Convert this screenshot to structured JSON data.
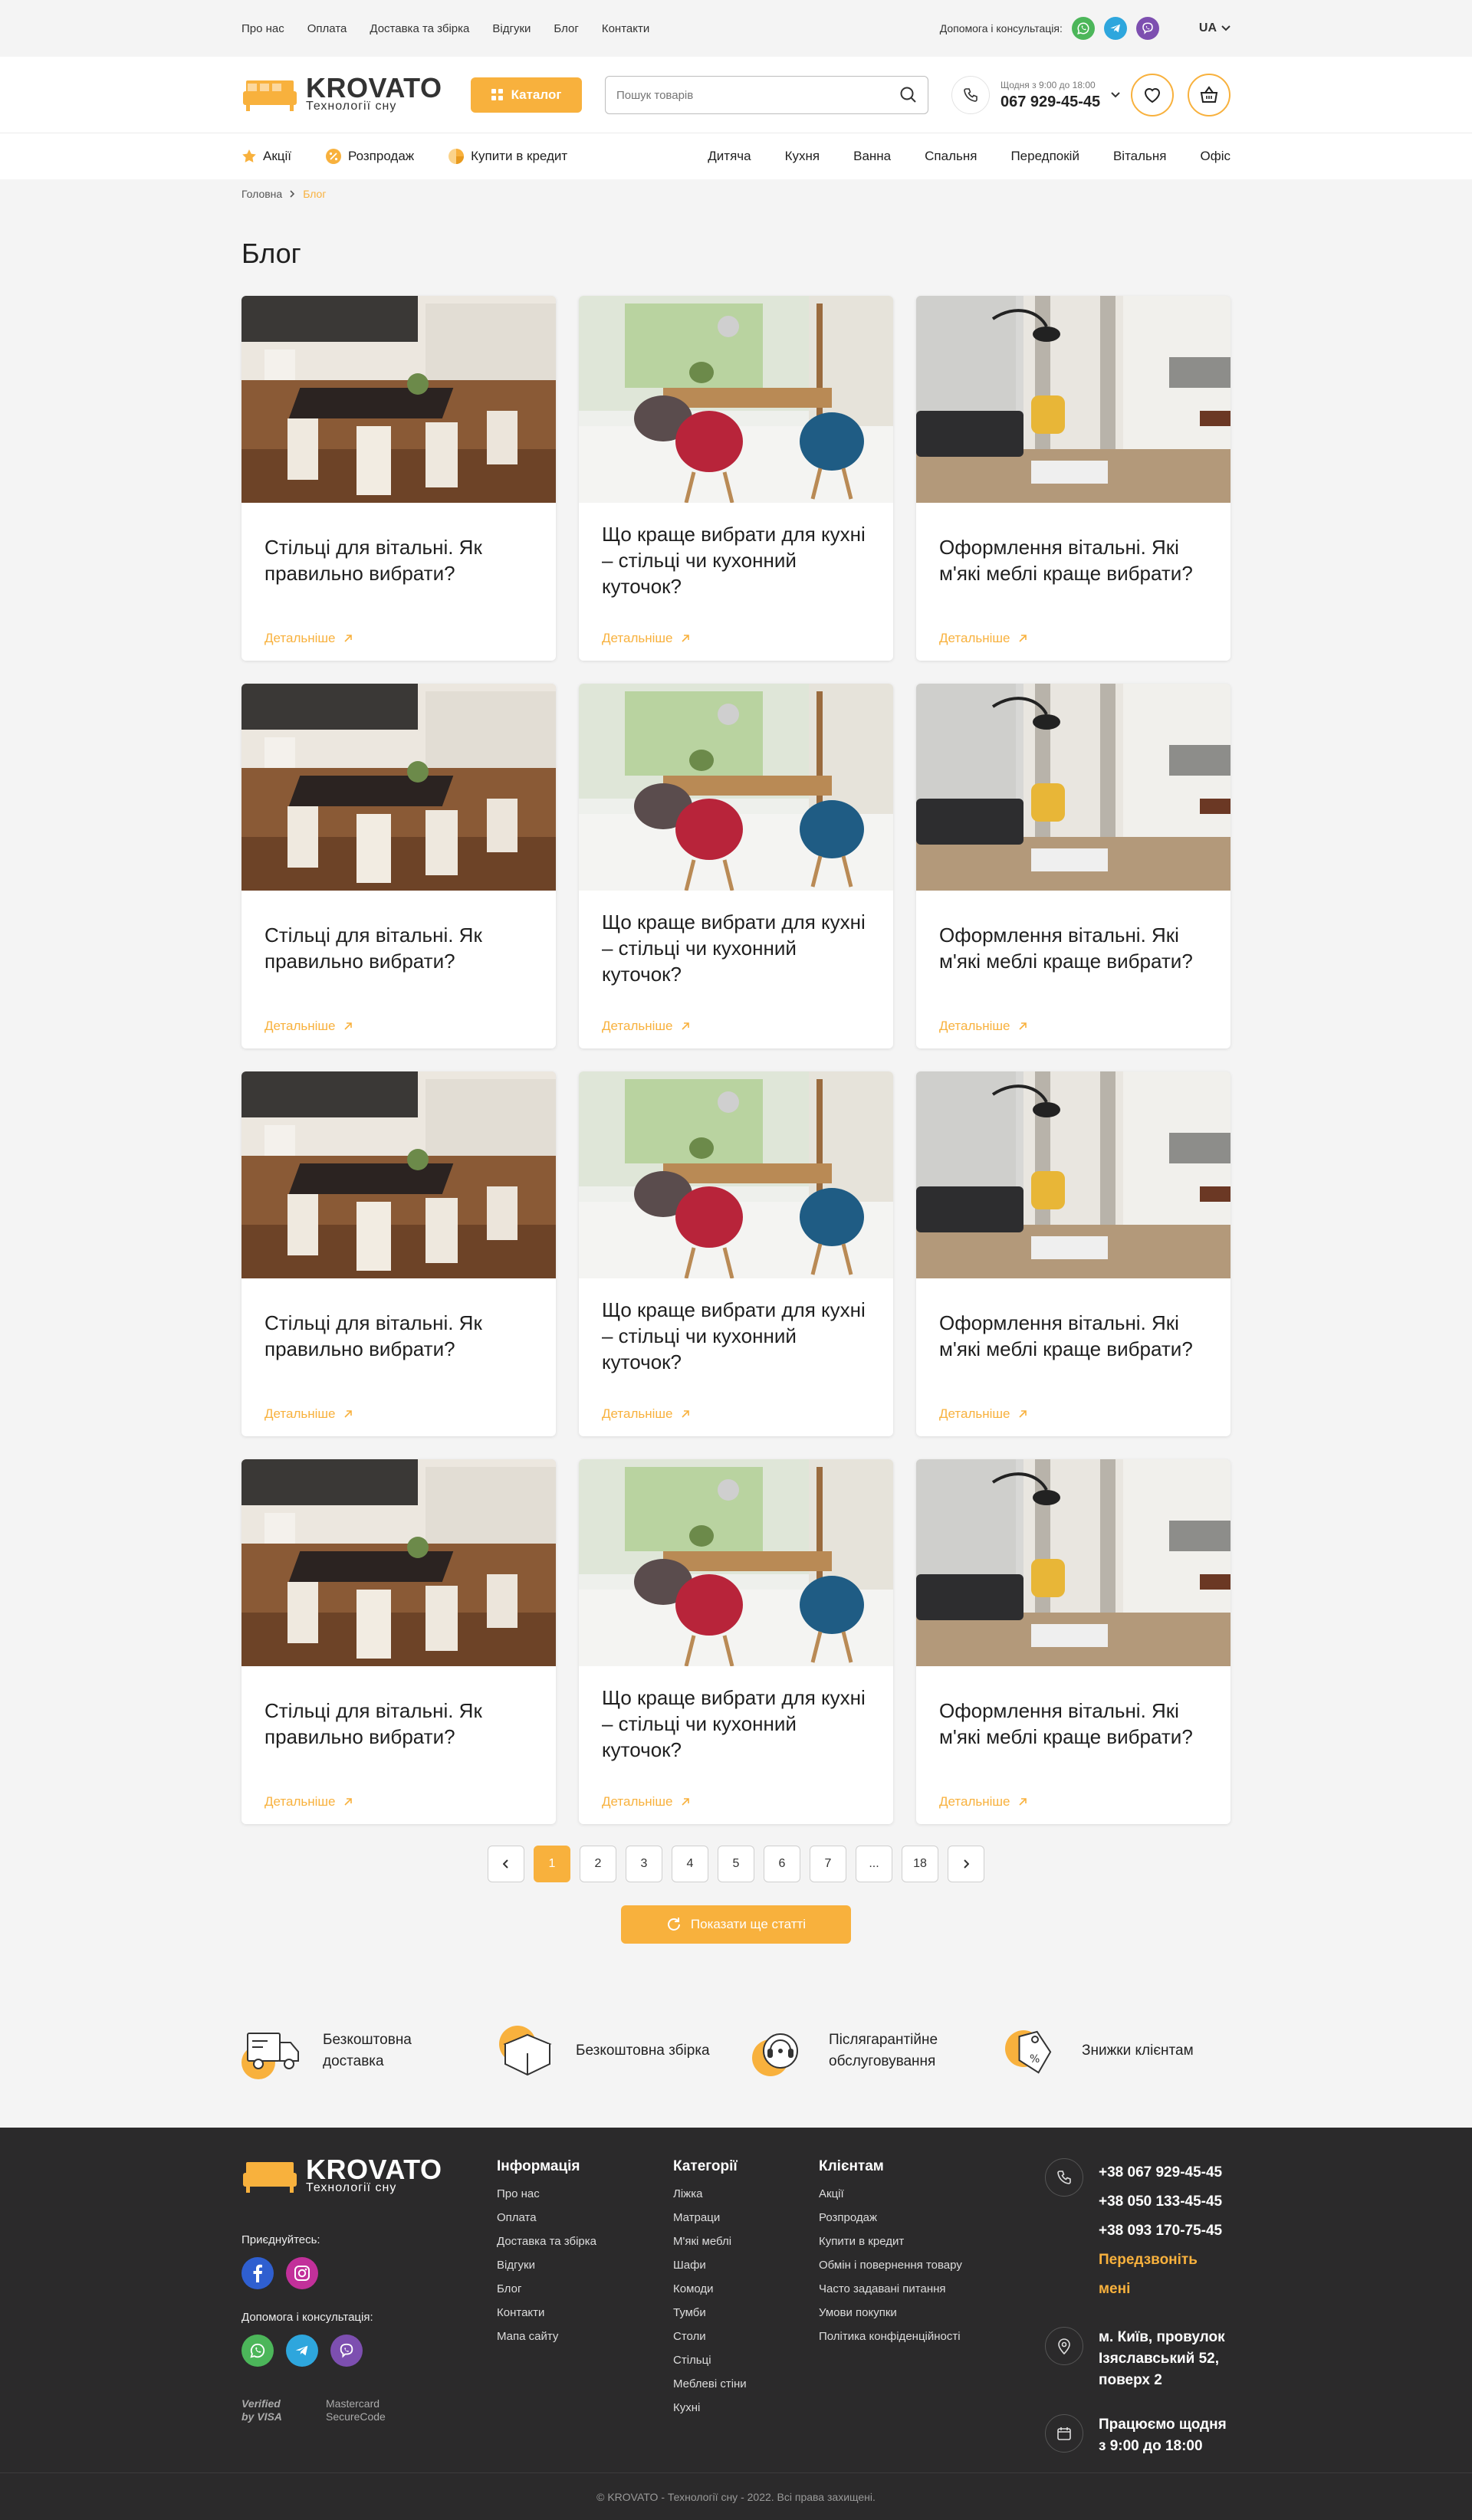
{
  "topbar": {
    "links": [
      "Про нас",
      "Оплата",
      "Доставка та збірка",
      "Відгуки",
      "Блог",
      "Контакти"
    ],
    "consult_label": "Допомога і консультація:",
    "lang": "UA"
  },
  "header": {
    "brand": "KROVATO",
    "tagline": "Технології сну",
    "catalog_label": "Каталог",
    "search_placeholder": "Пошук товарів",
    "hours": "Щодня з 9:00 до 18:00",
    "phone": "067 929-45-45"
  },
  "nav": {
    "left": [
      "Акції",
      "Розпродаж",
      "Купити в кредит"
    ],
    "right": [
      "Дитяча",
      "Кухня",
      "Ванна",
      "Спальня",
      "Передпокій",
      "Вітальня",
      "Офіс"
    ]
  },
  "breadcrumb": {
    "home": "Головна",
    "current": "Блог"
  },
  "page_title": "Блог",
  "more_label": "Детальніше",
  "articles": [
    {
      "title": "Стільці для вітальні. Як правильно вибрати?",
      "image": "dining-room-photo"
    },
    {
      "title": "Що краще вибрати для кухні – стільці чи кухонний куточок?",
      "image": "kitchen-chairs-photo"
    },
    {
      "title": "Оформлення вітальні. Які м'які меблі краще вибрати?",
      "image": "living-room-photo"
    },
    {
      "title": "Стільці для вітальні. Як правильно вибрати?",
      "image": "dining-room-photo"
    },
    {
      "title": "Що краще вибрати для кухні – стільці чи кухонний куточок?",
      "image": "kitchen-chairs-photo"
    },
    {
      "title": "Оформлення вітальні. Які м'які меблі краще вибрати?",
      "image": "living-room-photo"
    },
    {
      "title": "Стільці для вітальні. Як правильно вибрати?",
      "image": "dining-room-photo"
    },
    {
      "title": "Що краще вибрати для кухні – стільці чи кухонний куточок?",
      "image": "kitchen-chairs-photo"
    },
    {
      "title": "Оформлення вітальні. Які м'які меблі краще вибрати?",
      "image": "living-room-photo"
    },
    {
      "title": "Стільці для вітальні. Як правильно вибрати?",
      "image": "dining-room-photo"
    },
    {
      "title": "Що краще вибрати для кухні – стільці чи кухонний куточок?",
      "image": "kitchen-chairs-photo"
    },
    {
      "title": "Оформлення вітальні. Які м'які меблі краще вибрати?",
      "image": "living-room-photo"
    }
  ],
  "pagination": {
    "pages": [
      "1",
      "2",
      "3",
      "4",
      "5",
      "6",
      "7",
      "...",
      "18"
    ],
    "current": "1"
  },
  "load_more_label": "Показати ще статті",
  "features": [
    {
      "label": "Безкоштовна доставка",
      "icon": "truck-icon"
    },
    {
      "label": "Безкоштовна збірка",
      "icon": "box-icon"
    },
    {
      "label": "Післягарантійне обслуговування",
      "icon": "support-icon"
    },
    {
      "label": "Знижки клієнтам",
      "icon": "discount-tag-icon"
    }
  ],
  "footer": {
    "join_label": "Приєднуйтесь:",
    "consult_label": "Допомога і консультація:",
    "pay_verified": "Verified by VISA",
    "pay_mastercard": "Mastercard SecureCode",
    "info_title": "Інформація",
    "info_links": [
      "Про нас",
      "Оплата",
      "Доставка та збірка",
      "Відгуки",
      "Блог",
      "Контакти",
      "Мапа сайту"
    ],
    "cat_title": "Категорії",
    "cat_links": [
      "Ліжка",
      "Матраци",
      "М'які меблі",
      "Шафи",
      "Комоди",
      "Тумби",
      "Столи",
      "Стільці",
      "Меблеві стіни",
      "Кухні"
    ],
    "client_title": "Клієнтам",
    "client_links": [
      "Акції",
      "Розпродаж",
      "Купити в кредит",
      "Обмін і повернення товару",
      "Часто задавані питання",
      "Умови покупки",
      "Політика конфіденційності"
    ],
    "phones": [
      "+38 067 929-45-45",
      "+38 050 133-45-45",
      "+38 093 170-75-45"
    ],
    "callback": "Передзвоніть мені",
    "address": "м. Київ, провулок Ізяславський 52, поверх 2",
    "hours": "Працюємо щодня з 9:00 до 18:00",
    "copyright": "© KROVATO - Технології сну - 2022. Всі права захищені."
  },
  "colors": {
    "accent": "#f8b13d",
    "footer_bg": "#2b2a2b",
    "page_bg": "#f4f4f4"
  }
}
